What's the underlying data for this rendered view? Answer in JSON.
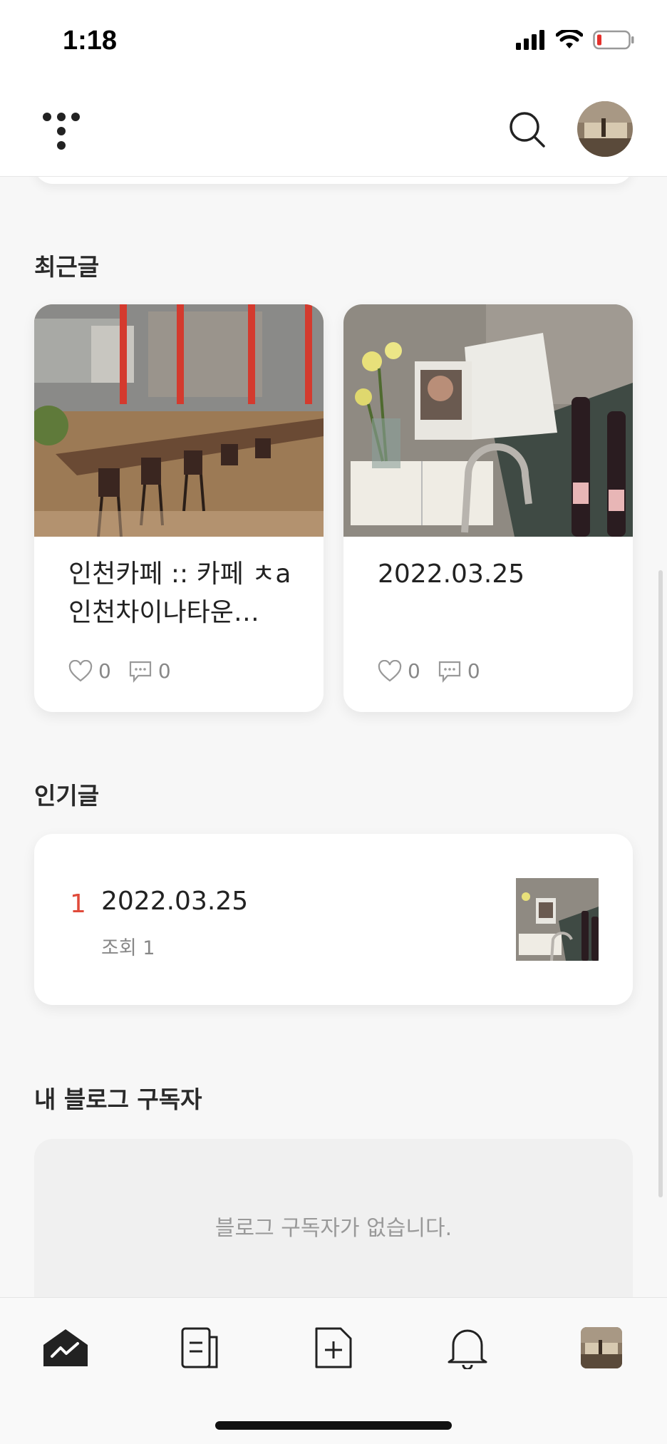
{
  "status_bar": {
    "time": "1:18"
  },
  "header": {
    "logo_icon": "tistory-logo-icon",
    "search_icon": "search-icon",
    "avatar_icon": "profile-avatar"
  },
  "sections": {
    "recent": "최근글",
    "popular": "인기글",
    "subscribers": "내 블로그 구독자"
  },
  "recent_posts": [
    {
      "title": "인천카페 :: 카페 ㅊa 인천차이나타운…",
      "likes": "0",
      "comments": "0",
      "thumb": "cafe-interior-photo"
    },
    {
      "title": "2022.03.25",
      "likes": "0",
      "comments": "0",
      "thumb": "still-life-photo"
    }
  ],
  "popular_posts": [
    {
      "rank": "1",
      "title": "2022.03.25",
      "views": "조회 1",
      "thumb": "still-life-photo"
    }
  ],
  "subscribers": {
    "empty_text": "블로그 구독자가 없습니다."
  },
  "bottom_nav": [
    "home-stats-icon",
    "posts-icon",
    "new-post-icon",
    "notification-bell-icon",
    "profile-avatar"
  ],
  "colors": {
    "accent_rank": "#e04a3a",
    "battery_low": "#e5302b"
  }
}
